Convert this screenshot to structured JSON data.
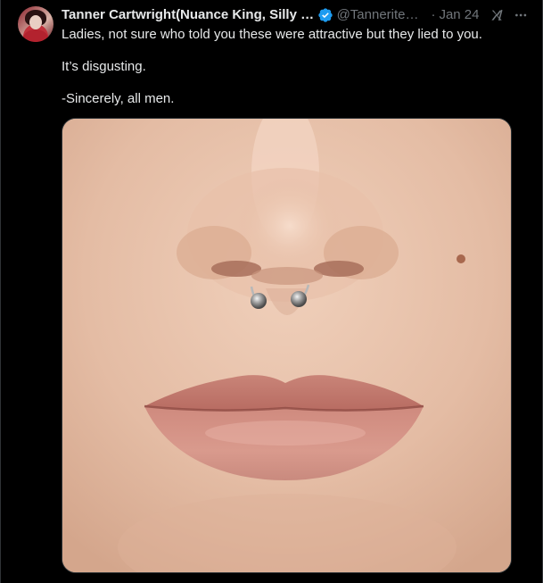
{
  "tweet": {
    "display_name": "Tanner Cartwright(Nuance King, Silly Bapt...",
    "handle": "@TanneriteCor...",
    "separator": "·",
    "date": "Jan 24",
    "lines": [
      "Ladies, not sure who told you these were attractive but they lied to you.",
      "It’s disgusting.",
      "-Sincerely, all men."
    ]
  },
  "icons": {
    "verified": "verified-badge-icon",
    "grok": "grok-icon",
    "more": "more-options-icon",
    "avatar": "user-avatar"
  },
  "colors": {
    "background": "#000000",
    "text_primary": "#e7e9ea",
    "text_secondary": "#71767b",
    "verified_blue": "#1d9bf0",
    "border": "#2f3336"
  }
}
